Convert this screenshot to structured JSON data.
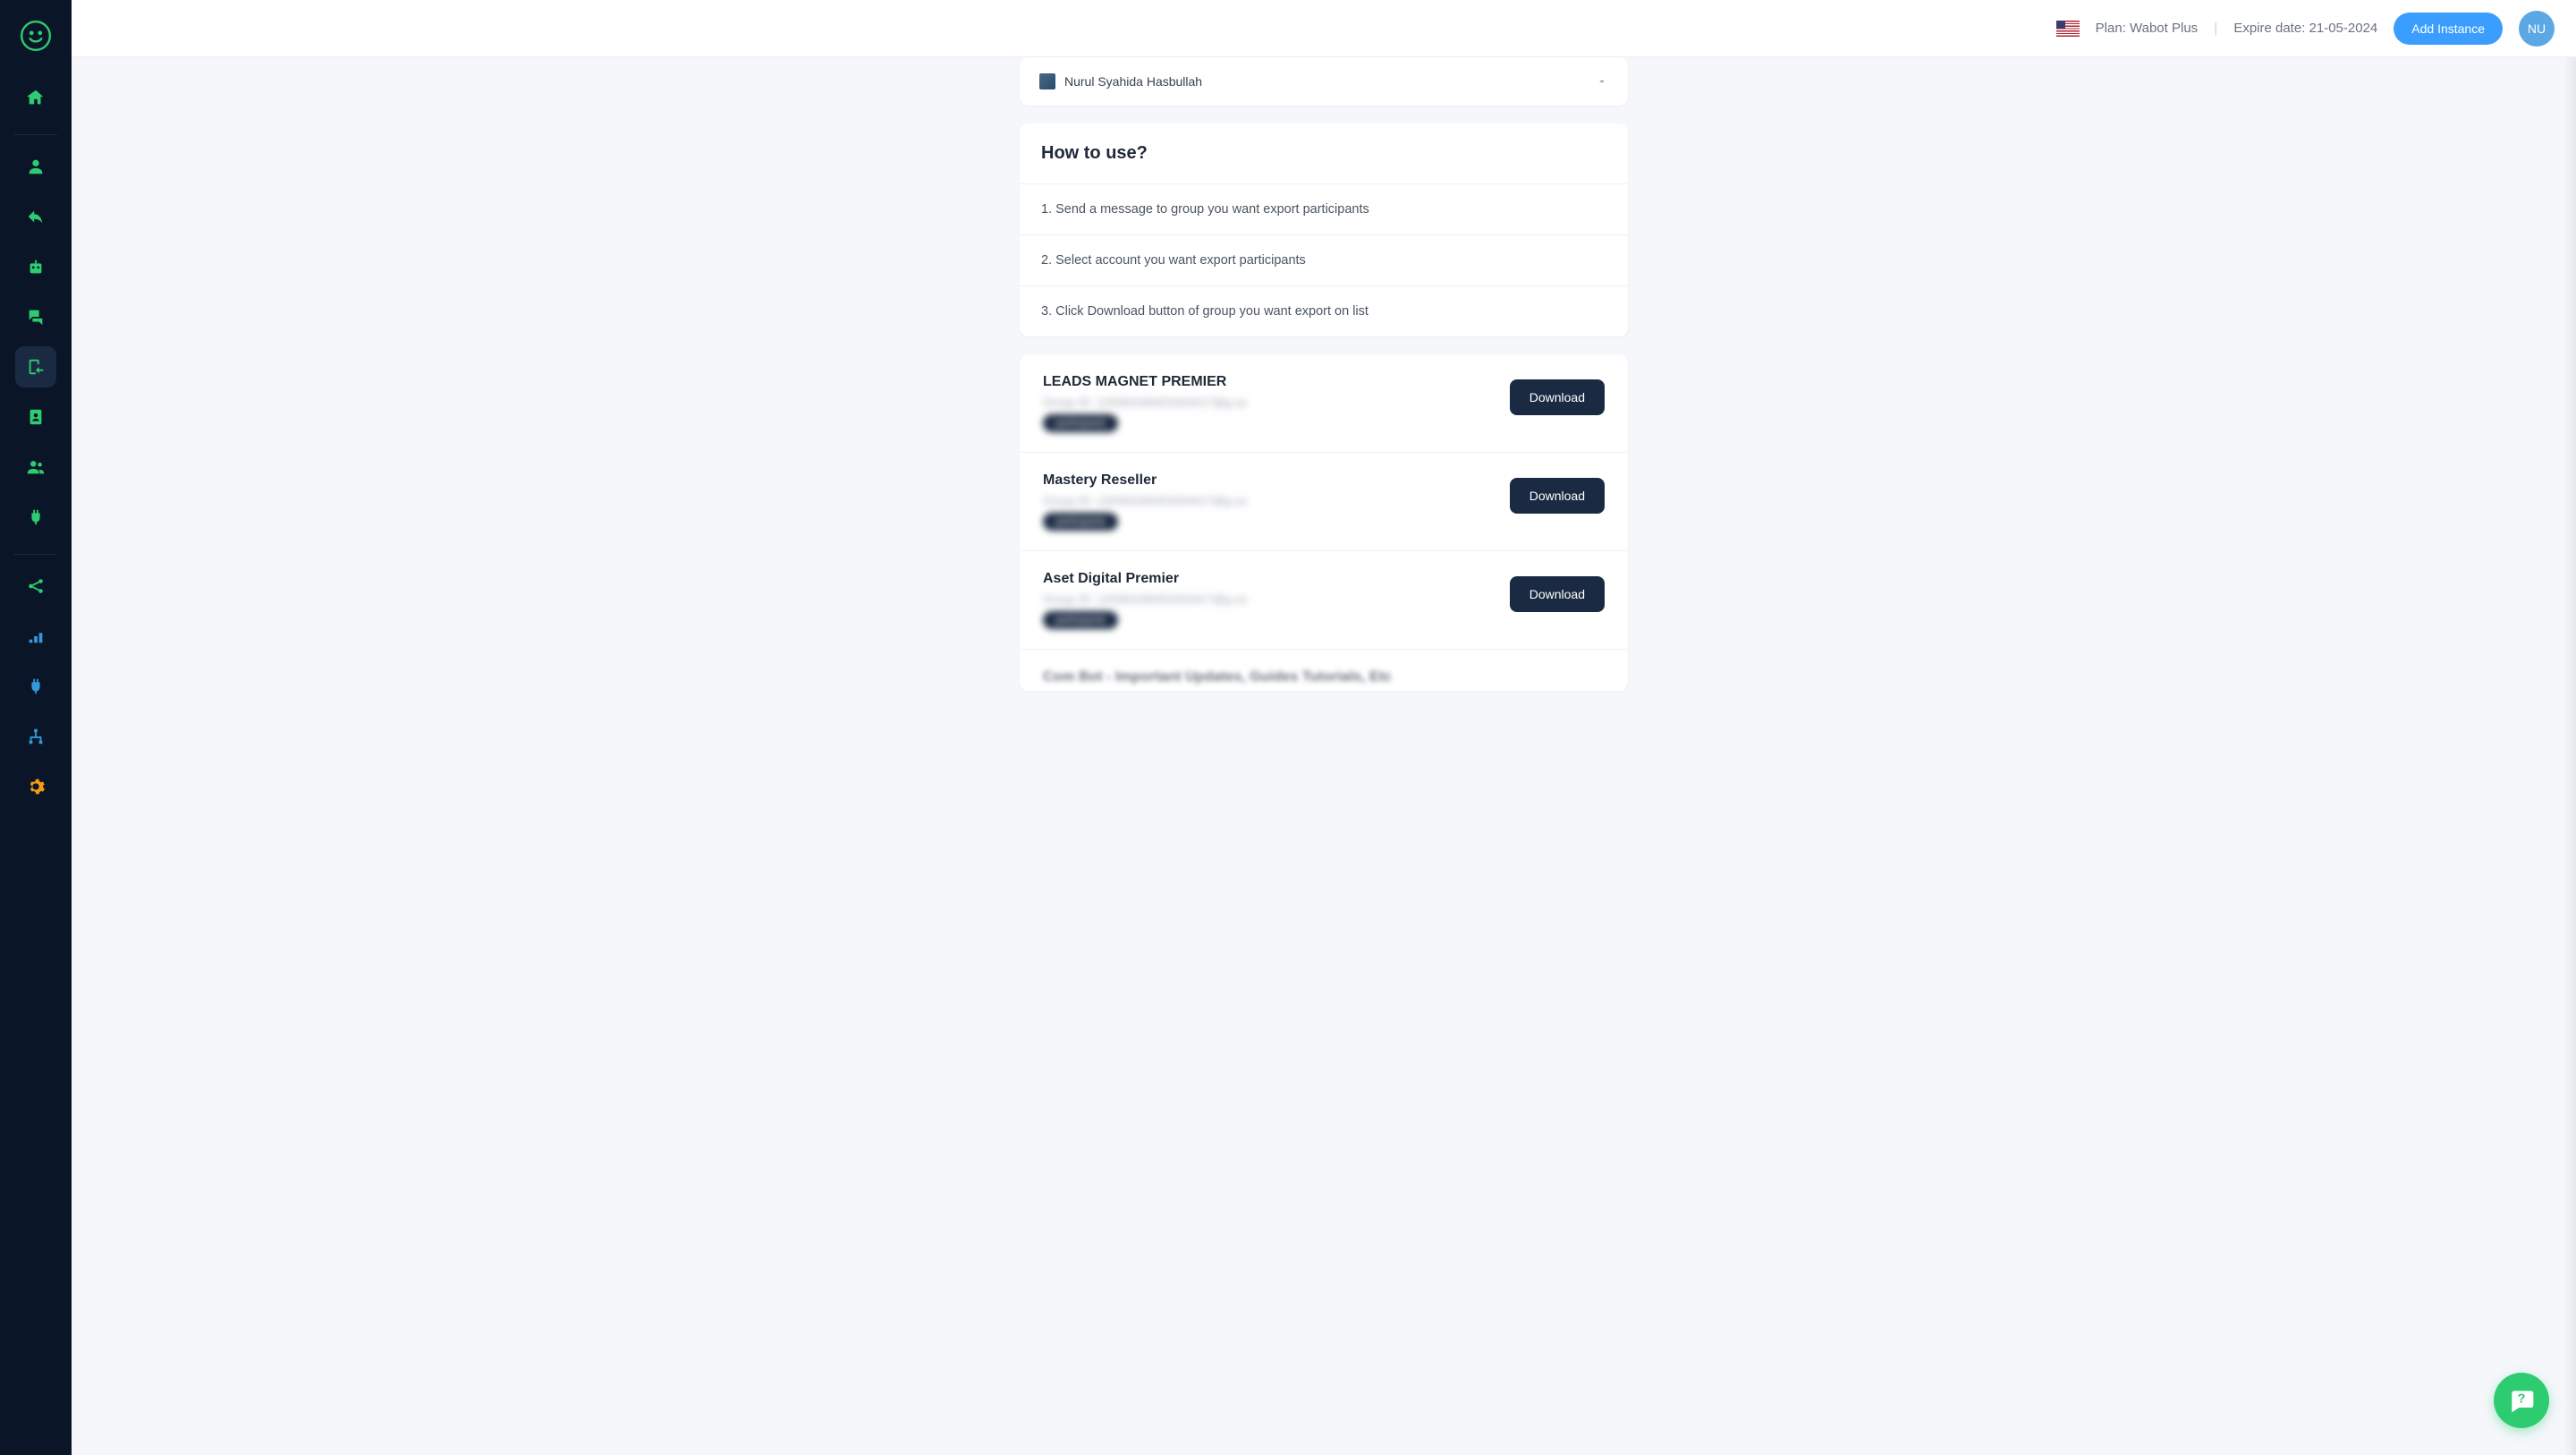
{
  "header": {
    "plan_label": "Plan: Wabot Plus",
    "expire_label": "Expire date: 21-05-2024",
    "add_instance": "Add Instance",
    "avatar_initials": "NU"
  },
  "account": {
    "name": "Nurul Syahida Hasbullah"
  },
  "howto": {
    "title": "How to use?",
    "steps": [
      "1. Send a message to group you want export participants",
      "2. Select account you want export participants",
      "3. Click Download button of group you want export on list"
    ]
  },
  "groups": [
    {
      "name": "LEADS MAGNET PREMIER",
      "id_text": "Group ID: 120363180453324417@g.us",
      "badge": "participants",
      "button": "Download"
    },
    {
      "name": "Mastery Reseller",
      "id_text": "Group ID: 120363180453324417@g.us",
      "badge": "participants",
      "button": "Download"
    },
    {
      "name": "Aset Digital Premier",
      "id_text": "Group ID: 120363180453324417@g.us",
      "badge": "participants",
      "button": "Download"
    }
  ],
  "partial_group": {
    "name": "Com Bot - Important Updates, Guides Tutorials, Etc"
  }
}
